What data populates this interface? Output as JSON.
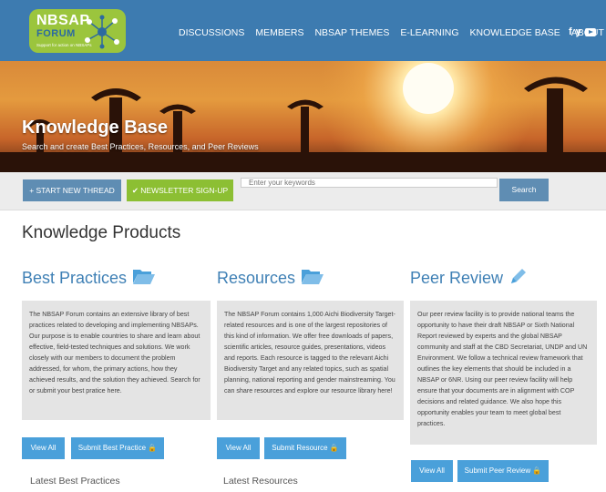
{
  "header": {
    "logo": {
      "line1": "NBSAP",
      "line2": "FORUM",
      "tagline": "Support for action on NBSAPs"
    },
    "nav": [
      "DISCUSSIONS",
      "MEMBERS",
      "NBSAP THEMES",
      "E-LEARNING",
      "KNOWLEDGE BASE",
      "ABOUT"
    ],
    "social": {
      "facebook": "f",
      "twitter": "y"
    }
  },
  "hero": {
    "title": "Knowledge Base",
    "subtitle": "Search and create Best Practices, Resources, and Peer Reviews"
  },
  "actions": {
    "start_thread": "+ START NEW THREAD",
    "newsletter": "✔ NEWSLETTER SIGN-UP",
    "search_placeholder": "Enter your keywords",
    "search_button": "Search"
  },
  "main": {
    "title": "Knowledge Products",
    "columns": [
      {
        "title": "Best Practices",
        "icon": "folder-open-icon",
        "description": "The NBSAP Forum contains an extensive library of best practices related to developing and implementing NBSAPs. Our purpose is to enable countries to share and learn about effective, field-tested techniques and solutions. We work closely with our members to document the problem addressed, for whom, the primary actions, how they achieved results, and the solution they achieved. Search for or submit your best pratice here.",
        "view_all": "View All",
        "submit": "Submit Best Practice 🔒",
        "latest": "Latest Best Practices"
      },
      {
        "title": "Resources",
        "icon": "folder-open-icon",
        "description": "The NBSAP Forum contains 1,000 Aichi Biodiversity Target-related resources and is one of the largest repositories of this kind of information. We offer free downloads of papers, scientific articles, resource guides, presentations, videos and reports. Each resource is tagged to the relevant Aichi Biodiversity Target and any related topics, such as spatial planning, national reporting and gender mainstreaming. You can share resources and explore our resource library here!",
        "view_all": "View All",
        "submit": "Submit Resource 🔒",
        "latest": "Latest Resources"
      },
      {
        "title": "Peer Review",
        "icon": "pencil-icon",
        "description": "Our peer review facility is to provide national teams the opportunity to have their draft NBSAP or Sixth National Report reviewed by experts and the global NBSAP community and staff at the CBD Secretariat, UNDP and UN Environment. We follow a technical review framework that outlines the key elements that should be included in a NBSAP or 6NR. Using our peer review facility will help ensure that your documents are in alignment with COP decisions and related guidance. We also hope this opportunity enables your team to meet global best practices.",
        "view_all": "View All",
        "submit": "Submit Peer Review 🔒"
      }
    ]
  },
  "colors": {
    "header": "#3d7bb0",
    "accent": "#3f80b5",
    "button_blue": "#4aa0da",
    "green": "#8cbf33"
  }
}
